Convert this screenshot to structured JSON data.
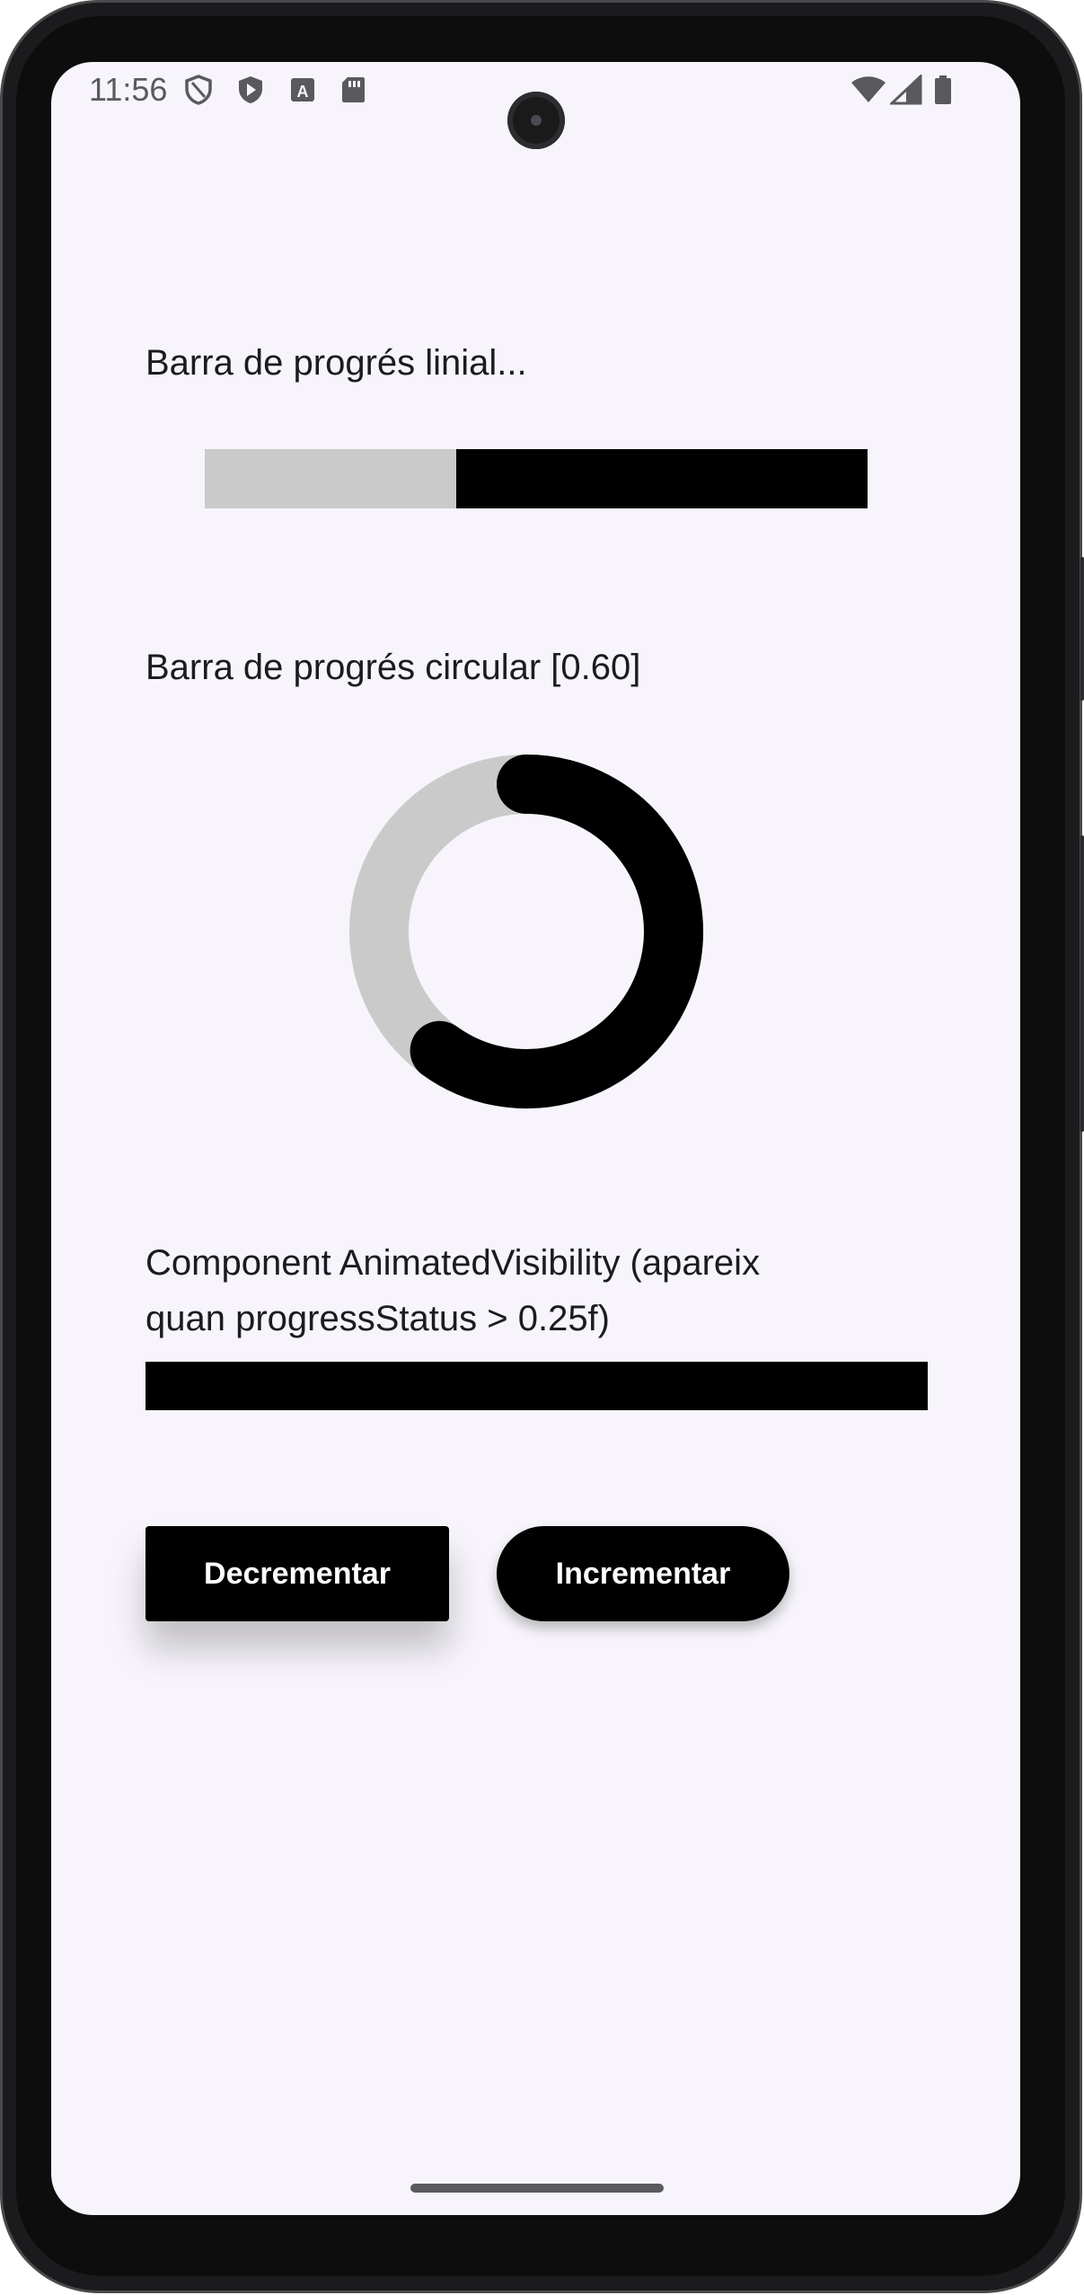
{
  "status_bar": {
    "time": "11:56",
    "left_icons": [
      "shield-outline-icon",
      "shield-play-icon",
      "a-square-icon",
      "sd-card-icon"
    ],
    "right_icons": [
      "wifi-icon",
      "signal-icon",
      "battery-icon"
    ]
  },
  "linear": {
    "label": "Barra de progrés linial...",
    "progress": 0.38
  },
  "circular": {
    "label": "Barra de progrés circular [0.60]",
    "progress": 0.6
  },
  "visibility": {
    "label_line1": "Component AnimatedVisibility (apareix",
    "label_line2": "quan progressStatus > 0.25f)"
  },
  "buttons": {
    "decrement_label": "Decrementar",
    "increment_label": "Incrementar"
  },
  "colors": {
    "background": "#f7f5fb",
    "progress_indicator": "#000000",
    "progress_track": "#cacaca",
    "text": "#1c1b1f"
  }
}
